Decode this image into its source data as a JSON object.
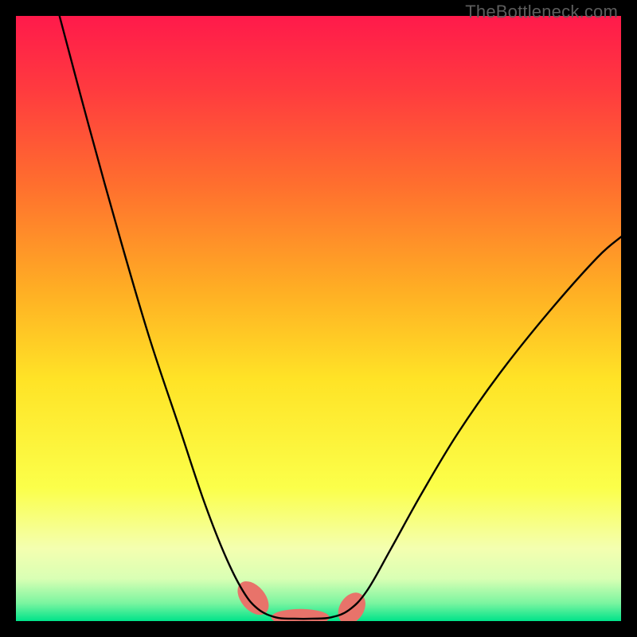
{
  "watermark": "TheBottleneck.com",
  "chart_data": {
    "type": "line",
    "title": "",
    "xlabel": "",
    "ylabel": "",
    "xlim": [
      0,
      100
    ],
    "ylim": [
      0,
      100
    ],
    "gradient_stops": [
      {
        "offset": 0.0,
        "color": "#ff1a4b"
      },
      {
        "offset": 0.12,
        "color": "#ff3a3f"
      },
      {
        "offset": 0.28,
        "color": "#ff6f2e"
      },
      {
        "offset": 0.45,
        "color": "#ffad24"
      },
      {
        "offset": 0.6,
        "color": "#ffe326"
      },
      {
        "offset": 0.78,
        "color": "#fbff4a"
      },
      {
        "offset": 0.88,
        "color": "#f4ffb0"
      },
      {
        "offset": 0.93,
        "color": "#d9ffb4"
      },
      {
        "offset": 0.97,
        "color": "#7cf5a0"
      },
      {
        "offset": 1.0,
        "color": "#00e38a"
      }
    ],
    "series": [
      {
        "name": "curve",
        "color": "#000000",
        "points": [
          {
            "x": 7.2,
            "y": 100.0
          },
          {
            "x": 12.0,
            "y": 82.0
          },
          {
            "x": 17.0,
            "y": 64.0
          },
          {
            "x": 22.0,
            "y": 47.0
          },
          {
            "x": 27.0,
            "y": 32.0
          },
          {
            "x": 31.0,
            "y": 20.0
          },
          {
            "x": 34.5,
            "y": 11.0
          },
          {
            "x": 37.5,
            "y": 5.0
          },
          {
            "x": 40.0,
            "y": 2.0
          },
          {
            "x": 43.0,
            "y": 0.6
          },
          {
            "x": 46.0,
            "y": 0.4
          },
          {
            "x": 49.0,
            "y": 0.4
          },
          {
            "x": 52.0,
            "y": 0.6
          },
          {
            "x": 55.0,
            "y": 1.8
          },
          {
            "x": 58.0,
            "y": 5.0
          },
          {
            "x": 62.0,
            "y": 12.0
          },
          {
            "x": 67.0,
            "y": 21.0
          },
          {
            "x": 73.0,
            "y": 31.0
          },
          {
            "x": 80.0,
            "y": 41.0
          },
          {
            "x": 88.0,
            "y": 51.0
          },
          {
            "x": 96.0,
            "y": 60.0
          },
          {
            "x": 100.0,
            "y": 63.5
          }
        ]
      }
    ],
    "markers": [
      {
        "name": "pill-left",
        "color": "#e8736a",
        "cx": 39.2,
        "cy": 3.8,
        "rx": 2.0,
        "ry": 3.2,
        "angle": -40
      },
      {
        "name": "pill-center",
        "color": "#e8736a",
        "cx": 47.0,
        "cy": 0.6,
        "rx": 4.8,
        "ry": 1.4,
        "angle": 0
      },
      {
        "name": "pill-right",
        "color": "#e8736a",
        "cx": 55.5,
        "cy": 2.1,
        "rx": 2.0,
        "ry": 2.8,
        "angle": 32
      }
    ]
  }
}
